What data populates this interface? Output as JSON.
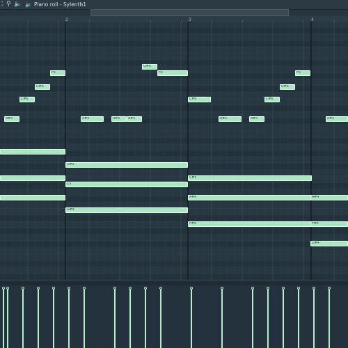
{
  "titlebar": {
    "title": "Piano roll - Sylenth1",
    "chevron": "›",
    "icons": [
      "fit-icon",
      "zoom-icon",
      "speaker-icon"
    ]
  },
  "ruler": {
    "bar_labels": [
      "2",
      "3",
      "4"
    ]
  },
  "colors": {
    "background": "#26353f",
    "note": "#a8e8bf",
    "velocity": "#b4f0c8"
  },
  "notes": [
    {
      "label": "A#5"
    },
    {
      "label": "C#6"
    },
    {
      "label": "D#6"
    },
    {
      "label": "F6"
    },
    {
      "label": ""
    },
    {
      "label": ""
    },
    {
      "label": ""
    },
    {
      "label": "A#5"
    },
    {
      "label": "A#5"
    },
    {
      "label": "A#5"
    },
    {
      "label": "G#6"
    },
    {
      "label": "F6"
    },
    {
      "label": "D#5"
    },
    {
      "label": "C5"
    },
    {
      "label": "G#4"
    },
    {
      "label": "C#6"
    },
    {
      "label": "A#5"
    },
    {
      "label": "A#5"
    },
    {
      "label": "C#6"
    },
    {
      "label": "D#6"
    },
    {
      "label": "F6"
    },
    {
      "label": "C#5"
    },
    {
      "label": "A#4"
    },
    {
      "label": "F#4"
    },
    {
      "label": "A#5"
    },
    {
      "label": "A#4"
    },
    {
      "label": "F#4"
    },
    {
      "label": "D#4"
    }
  ]
}
